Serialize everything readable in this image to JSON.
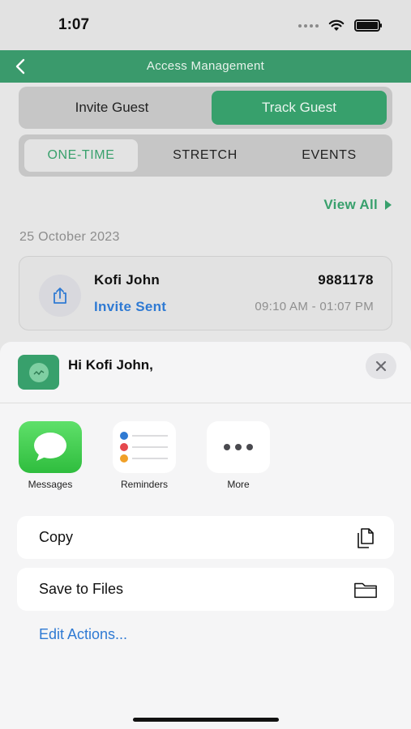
{
  "status_bar": {
    "time": "1:07"
  },
  "header": {
    "title": "Access Management"
  },
  "tabs_main": [
    {
      "label": "Invite Guest",
      "active": false
    },
    {
      "label": "Track Guest",
      "active": true
    }
  ],
  "tabs_sub": [
    {
      "label": "ONE-TIME",
      "active": true
    },
    {
      "label": "STRETCH",
      "active": false
    },
    {
      "label": "EVENTS",
      "active": false
    }
  ],
  "view_all": "View All",
  "date_label": "25 October 2023",
  "guest_card": {
    "name": "Kofi John",
    "status": "Invite Sent",
    "code": "9881178",
    "time_range": "09:10 AM - 01:07 PM"
  },
  "share_sheet": {
    "title": "Hi Kofi John,",
    "apps": [
      {
        "label": "Messages",
        "icon": "messages-app-icon"
      },
      {
        "label": "Reminders",
        "icon": "reminders-app-icon"
      },
      {
        "label": "More",
        "icon": "more-dots-icon"
      }
    ],
    "actions": [
      {
        "label": "Copy",
        "icon": "copy-icon"
      },
      {
        "label": "Save to Files",
        "icon": "folder-icon"
      }
    ],
    "edit_actions": "Edit Actions..."
  },
  "colors": {
    "brand_green": "#38a06c",
    "link_blue": "#2f7ad3",
    "sheet_bg": "#f5f5f6"
  }
}
